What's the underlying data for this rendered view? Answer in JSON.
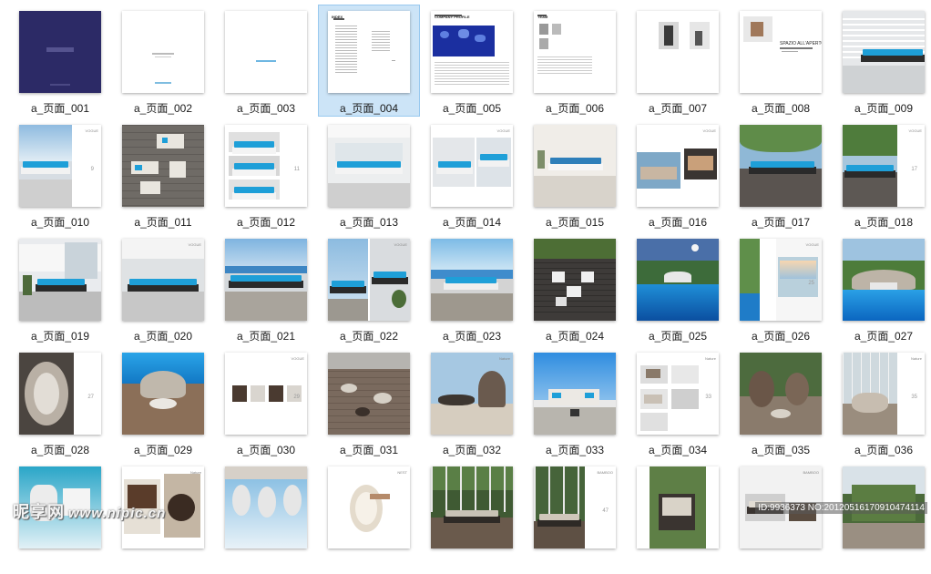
{
  "items": [
    {
      "label": "a_页面_001",
      "kind": "navy"
    },
    {
      "label": "a_页面_002",
      "kind": "whitetitle"
    },
    {
      "label": "a_页面_003",
      "kind": "whitelogo"
    },
    {
      "label": "a_页面_004",
      "kind": "index",
      "selected": true,
      "heading": "INDEX"
    },
    {
      "label": "a_页面_005",
      "kind": "map",
      "heading": "COMPANY PROFILE"
    },
    {
      "label": "a_页面_006",
      "kind": "team",
      "heading": "TEAM"
    },
    {
      "label": "a_页面_007",
      "kind": "people"
    },
    {
      "label": "a_页面_008",
      "kind": "chairtext",
      "caption": "SPAZIO ALL'APERTO"
    },
    {
      "label": "a_页面_009",
      "kind": "terrace"
    },
    {
      "label": "a_页面_010",
      "kind": "sofaside",
      "tag": "VOGUE",
      "num": "9"
    },
    {
      "label": "a_页面_011",
      "kind": "topdown"
    },
    {
      "label": "a_页面_012",
      "kind": "triple",
      "num": "11"
    },
    {
      "label": "a_页面_013",
      "kind": "interior"
    },
    {
      "label": "a_页面_014",
      "kind": "splitroom",
      "tag": "VOGUE"
    },
    {
      "label": "a_页面_015",
      "kind": "sofawall"
    },
    {
      "label": "a_页面_016",
      "kind": "beds",
      "tag": "VOGUE"
    },
    {
      "label": "a_页面_017",
      "kind": "trees"
    },
    {
      "label": "a_页面_018",
      "kind": "treesside",
      "tag": "VOGUE",
      "num": "17"
    },
    {
      "label": "a_页面_019",
      "kind": "house"
    },
    {
      "label": "a_页面_020",
      "kind": "darkroom",
      "tag": "VOGUE"
    },
    {
      "label": "a_页面_021",
      "kind": "seaview"
    },
    {
      "label": "a_页面_022",
      "kind": "halves",
      "tag": "VOGUE"
    },
    {
      "label": "a_页面_023",
      "kind": "beachsofa"
    },
    {
      "label": "a_页面_024",
      "kind": "gardenset"
    },
    {
      "label": "a_页面_025",
      "kind": "poolnight"
    },
    {
      "label": "a_页面_026",
      "kind": "poolside",
      "tag": "VOGUE",
      "num": "25"
    },
    {
      "label": "a_页面_027",
      "kind": "poolround"
    },
    {
      "label": "a_页面_028",
      "kind": "roundside",
      "num": "27"
    },
    {
      "label": "a_页面_029",
      "kind": "poolwood"
    },
    {
      "label": "a_页面_030",
      "kind": "chairs",
      "tag": "VOGUE",
      "num": "29"
    },
    {
      "label": "a_页面_031",
      "kind": "deck"
    },
    {
      "label": "a_页面_032",
      "kind": "canopy",
      "tag": "Nature"
    },
    {
      "label": "a_页面_033",
      "kind": "daybed"
    },
    {
      "label": "a_页面_034",
      "kind": "collage",
      "tag": "Nature",
      "num": "33"
    },
    {
      "label": "a_页面_035",
      "kind": "eggs"
    },
    {
      "label": "a_页面_036",
      "kind": "glasshouse",
      "tag": "Nature",
      "num": "35"
    },
    {
      "label": "",
      "kind": "tealbath"
    },
    {
      "label": "",
      "kind": "hanging",
      "tag": "Nature"
    },
    {
      "label": "",
      "kind": "swings"
    },
    {
      "label": "",
      "kind": "eggchair",
      "tag": "NEST"
    },
    {
      "label": "",
      "kind": "pergola"
    },
    {
      "label": "",
      "kind": "pergolaside",
      "tag": "BAMBOO",
      "num": "47"
    },
    {
      "label": "",
      "kind": "armchair"
    },
    {
      "label": "",
      "kind": "outdoorset",
      "tag": "BAMBOO"
    },
    {
      "label": "",
      "kind": "hedge"
    }
  ],
  "watermark": {
    "brand": "昵享网",
    "url": "www.nipic.cn"
  },
  "image_id": "ID:9936373 NO:20120516170910474114",
  "colors": {
    "selection_bg": "#cce4f7",
    "selection_border": "#99c9ef",
    "navy": "#2c2a66",
    "sofa_blue": "#1e9fd8"
  }
}
